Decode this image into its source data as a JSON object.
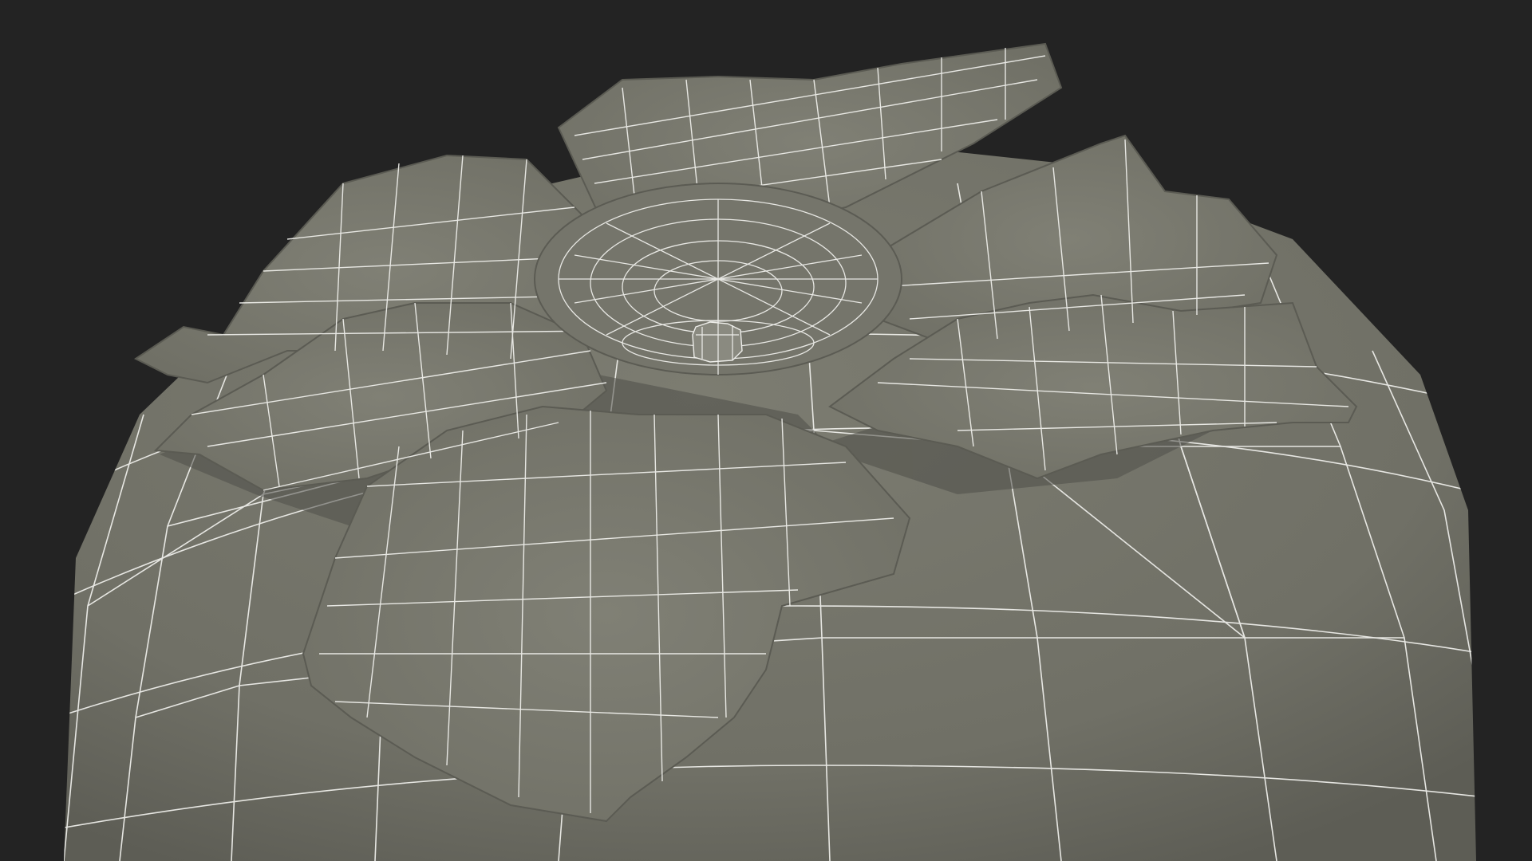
{
  "scene": {
    "subject": "wireframe-3d-model",
    "background_color": "#232323",
    "surface_color": "#737368",
    "leaf_color": "#7a7a6f",
    "leaf_shadow_color": "#5e5e55",
    "wire_color": "#eeeeea"
  }
}
